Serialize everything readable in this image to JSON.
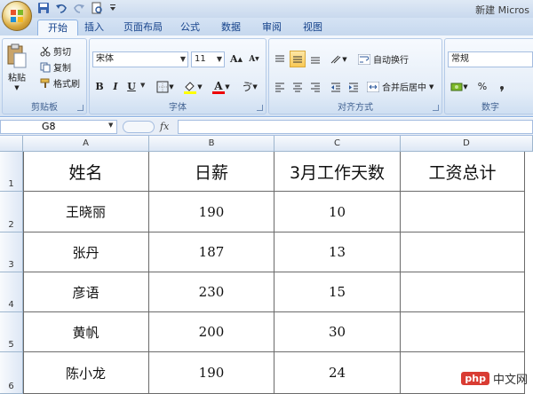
{
  "window": {
    "title": "新建 Micros"
  },
  "tabs": [
    "开始",
    "插入",
    "页面布局",
    "公式",
    "数据",
    "审阅",
    "视图"
  ],
  "ribbon": {
    "clipboard": {
      "label": "剪贴板",
      "paste": "粘贴",
      "cut": "剪切",
      "copy": "复制",
      "format_painter": "格式刷"
    },
    "font": {
      "label": "字体",
      "font_name": "宋体",
      "font_size": "11",
      "grow": "A",
      "shrink": "A",
      "bold": "B",
      "italic": "I",
      "underline": "U",
      "font_color_glyph": "A",
      "phonetic": "ゔ"
    },
    "alignment": {
      "label": "对齐方式",
      "wrap_text": "自动换行",
      "merge_center": "合并后居中"
    },
    "number": {
      "label": "数字",
      "format": "常规",
      "percent": "%"
    }
  },
  "formula_bar": {
    "name_box": "G8",
    "fx": "fx",
    "formula": ""
  },
  "columns": [
    "A",
    "B",
    "C",
    "D"
  ],
  "rows": [
    "1",
    "2",
    "3",
    "4",
    "5",
    "6"
  ],
  "table": {
    "headers": [
      "姓名",
      "日薪",
      "3月工作天数",
      "工资总计"
    ],
    "rows": [
      [
        "王晓丽",
        "190",
        "10",
        ""
      ],
      [
        "张丹",
        "187",
        "13",
        ""
      ],
      [
        "彦语",
        "230",
        "15",
        ""
      ],
      [
        "黄帆",
        "200",
        "30",
        ""
      ],
      [
        "陈小龙",
        "190",
        "24",
        ""
      ]
    ]
  },
  "watermark": {
    "badge": "php",
    "text": "中文网"
  }
}
